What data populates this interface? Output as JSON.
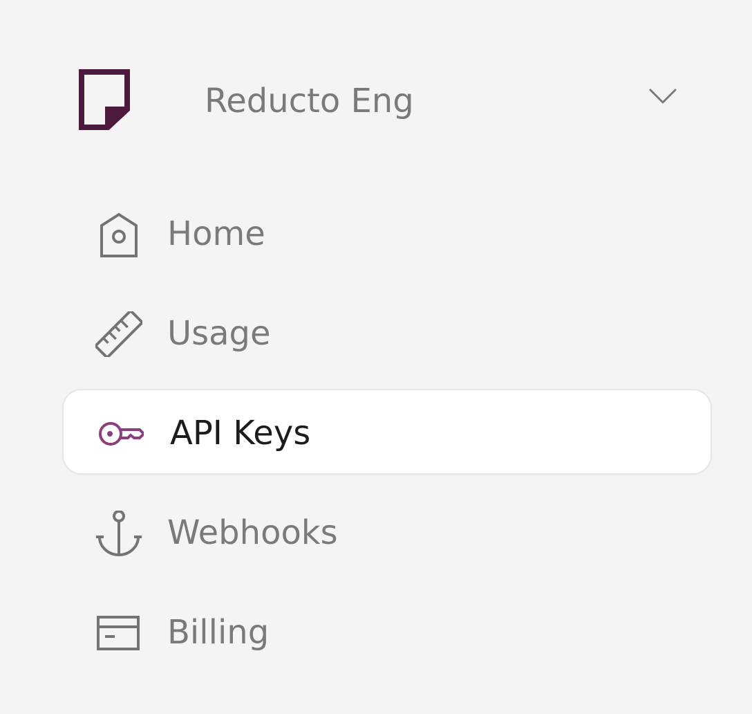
{
  "org": {
    "name": "Reducto Eng",
    "logo_color": "#4b1a3d"
  },
  "nav": {
    "items": [
      {
        "label": "Home",
        "icon": "home-icon",
        "active": false
      },
      {
        "label": "Usage",
        "icon": "ruler-icon",
        "active": false
      },
      {
        "label": "API Keys",
        "icon": "key-icon",
        "active": true
      },
      {
        "label": "Webhooks",
        "icon": "anchor-icon",
        "active": false
      },
      {
        "label": "Billing",
        "icon": "billing-card-icon",
        "active": false
      }
    ]
  },
  "colors": {
    "background": "#f4f4f4",
    "active_bg": "#ffffff",
    "text_muted": "#7a7a7a",
    "text_active": "#1c1c1c",
    "accent": "#8b3f7d",
    "icon_gray": "#747474"
  }
}
